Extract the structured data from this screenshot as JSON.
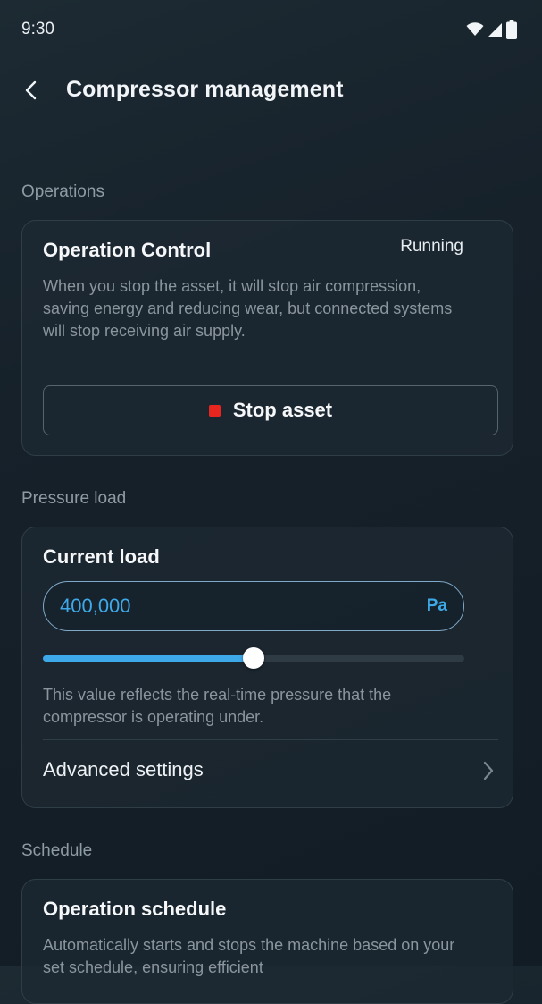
{
  "status_bar": {
    "time": "9:30",
    "icons": [
      "wifi-icon",
      "signal-icon",
      "battery-icon"
    ]
  },
  "header": {
    "title": "Compressor management",
    "back_icon": "chevron-left-icon"
  },
  "operations": {
    "section_label": "Operations",
    "card_title": "Operation Control",
    "status": "Running",
    "description": "When you stop the asset, it will stop air compression, saving energy and reducing wear, but connected systems will stop receiving air supply.",
    "stop_button_label": "Stop asset",
    "stop_color": "#e8261f"
  },
  "pressure": {
    "section_label": "Pressure load",
    "card_title": "Current load",
    "value": "400,000",
    "unit": "Pa",
    "slider_fraction": 0.5,
    "description": "This value reflects the real-time pressure that the compressor is operating under.",
    "advanced_label": "Advanced settings",
    "accent_color": "#3ea9e9"
  },
  "schedule": {
    "section_label": "Schedule",
    "card_title": "Operation schedule",
    "description": "Automatically starts and stops the machine based on your set schedule, ensuring efficient"
  }
}
